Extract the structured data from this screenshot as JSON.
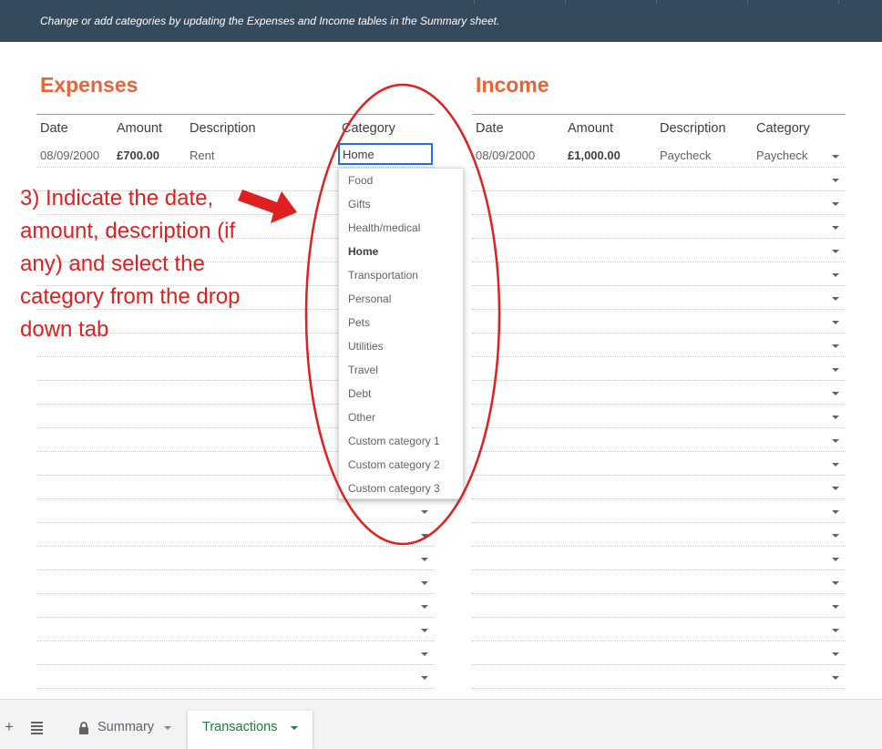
{
  "banner": {
    "text": "Change or add categories by updating the Expenses and Income tables in the Summary sheet."
  },
  "expenses": {
    "title": "Expenses",
    "columns": [
      "Date",
      "Amount",
      "Description",
      "Category"
    ],
    "row": {
      "date": "08/09/2000",
      "amount": "£700.00",
      "description": "Rent",
      "category": "Home"
    }
  },
  "income": {
    "title": "Income",
    "columns": [
      "Date",
      "Amount",
      "Description",
      "Category"
    ],
    "row": {
      "date": "08/09/2000",
      "amount": "£1,000.00",
      "description": "Paycheck",
      "category": "Paycheck"
    }
  },
  "category_dropdown": {
    "selected": "Home",
    "options": [
      "Food",
      "Gifts",
      "Health/medical",
      "Home",
      "Transportation",
      "Personal",
      "Pets",
      "Utilities",
      "Travel",
      "Debt",
      "Other",
      "Custom category 1",
      "Custom category 2",
      "Custom category 3"
    ]
  },
  "annotation": {
    "text": "3) Indicate the date, amount, description (if any) and select the category from the drop down tab"
  },
  "sheet_tabs": {
    "add_icon": "plus-icon",
    "menu_icon": "list-icon",
    "tabs": [
      {
        "label": "Summary",
        "icon": "lock-icon",
        "active": false
      },
      {
        "label": "Transactions",
        "active": true
      }
    ]
  },
  "colors": {
    "banner": "#364a5e",
    "section_title": "#e8643a",
    "annotation": "#e02020",
    "active_tab": "#188038",
    "focus": "#1a73e8"
  }
}
